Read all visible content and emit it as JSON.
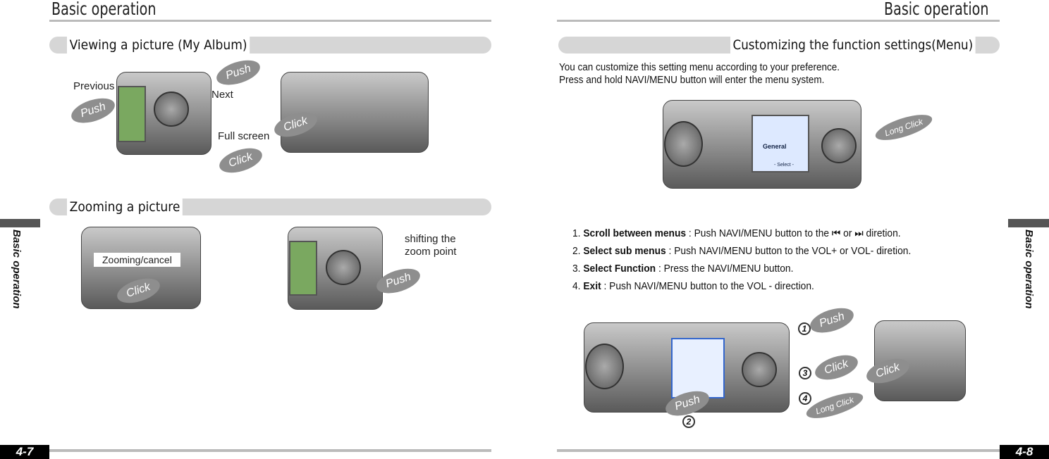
{
  "left_page": {
    "header": "Basic operation",
    "side_tab": "Basic operation",
    "page_number": "4-7",
    "sections": [
      {
        "title": "Viewing a picture (My Album)",
        "labels": [
          "Previous",
          "Next",
          "Full screen"
        ],
        "bursts": [
          "Push",
          "Push",
          "Click",
          "Click"
        ]
      },
      {
        "title": "Zooming a picture",
        "labels": [
          "Zooming/cancel",
          "shifting the zoom point"
        ],
        "bursts": [
          "Click",
          "Push"
        ]
      }
    ]
  },
  "right_page": {
    "header": "Basic operation",
    "side_tab": "Basic operation",
    "page_number": "4-8",
    "section_title": "Customizing the function settings(Menu)",
    "intro": [
      "You can customize this setting menu according to your preference.",
      "Press and hold NAVI/MENU button will enter the menu system."
    ],
    "device_bursts": [
      "Long Click",
      "Push",
      "Click",
      "Long Click",
      "Push",
      "Click"
    ],
    "screen_text": {
      "general": "General",
      "select": "- Select -"
    },
    "steps": [
      {
        "num": "1.",
        "title": "Scroll between menus",
        "text": " : Push NAVI/MENU button to the ⏮ or ⏭ diretion."
      },
      {
        "num": "2.",
        "title": "Select sub menus",
        "text": " : Push NAVI/MENU button to the VOL+ or  VOL- diretion."
      },
      {
        "num": "3.",
        "title": "Select Function",
        "text": " : Press the NAVI/MENU button."
      },
      {
        "num": "4.",
        "title": "Exit",
        "text": " : Push NAVI/MENU button to the VOL - direction."
      }
    ],
    "callouts": [
      "1",
      "2",
      "3",
      "4"
    ]
  }
}
